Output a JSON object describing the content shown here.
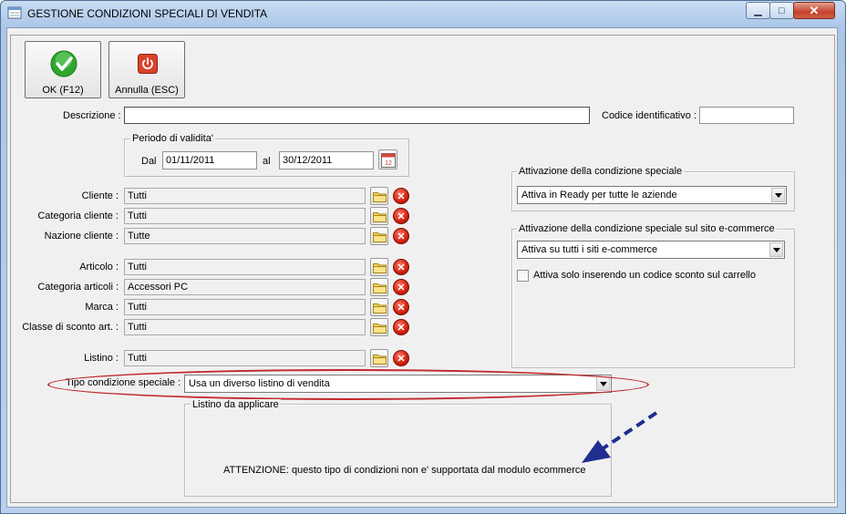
{
  "window": {
    "title": "GESTIONE CONDIZIONI SPECIALI DI VENDITA",
    "minimize_glyph": "▁",
    "maximize_glyph": "□",
    "close_glyph": "✕"
  },
  "toolbar": {
    "ok_label": "OK (F12)",
    "cancel_label": "Annulla (ESC)"
  },
  "header": {
    "descrizione_label": "Descrizione :",
    "descrizione_value": "",
    "codice_label": "Codice identificativo :",
    "codice_value": ""
  },
  "periodo": {
    "title": "Periodo di validita'",
    "dal_label": "Dal",
    "dal_value": "01/11/2011",
    "al_label": "al",
    "al_value": "30/12/2011",
    "calendar_text": "12"
  },
  "filters": [
    {
      "label": "Cliente :",
      "value": "Tutti"
    },
    {
      "label": "Categoria cliente :",
      "value": "Tutti"
    },
    {
      "label": "Nazione cliente :",
      "value": "Tutte"
    },
    {
      "label": "Articolo :",
      "value": "Tutti"
    },
    {
      "label": "Categoria articoli :",
      "value": "Accessori PC"
    },
    {
      "label": "Marca :",
      "value": "Tutti"
    },
    {
      "label": "Classe di sconto art. :",
      "value": "Tutti"
    },
    {
      "label": "Listino :",
      "value": "Tutti"
    }
  ],
  "attivazione": {
    "title": "Attivazione della condizione speciale",
    "value": "Attiva in Ready per tutte le aziende"
  },
  "attivazione_ecommerce": {
    "title": "Attivazione della condizione speciale sul sito e-commerce",
    "value": "Attiva su tutti i siti e-commerce",
    "checkbox_label": "Attiva solo inserendo un codice sconto sul carrello",
    "checkbox_checked": false
  },
  "tipo_condizione": {
    "label": "Tipo condizione speciale :",
    "value": "Usa un diverso listino di vendita"
  },
  "listino_applicare": {
    "title": "Listino da applicare",
    "warning": "ATTENZIONE: questo tipo di condizioni non e' supportata dal modulo ecommerce"
  },
  "colors": {
    "annotation_ellipse": "#c2272d",
    "annotation_arrow": "#1f2e8f",
    "ok_green": "#2fa72f",
    "cancel_red": "#d9432b"
  }
}
